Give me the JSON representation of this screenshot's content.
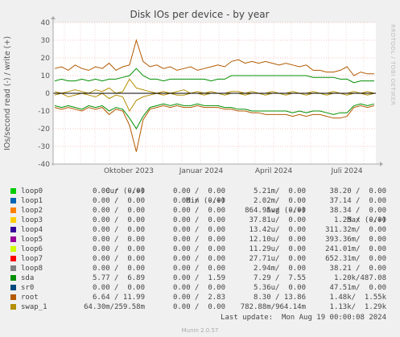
{
  "chart_data": {
    "type": "line",
    "title": "Disk IOs per device - by year",
    "ylabel": "IOs/second read (-) / write (+)",
    "ylim": [
      -40,
      40
    ],
    "yticks": [
      40,
      30,
      20,
      10,
      0,
      -10,
      -20,
      -30,
      -40
    ],
    "xtick_labels": [
      "Oktober 2023",
      "Januar 2024",
      "April 2024",
      "Juli 2024"
    ],
    "side_label": "RRDTOOL / TOBI OETIKER",
    "series": [
      {
        "name": "root",
        "write": [
          14,
          15,
          13,
          16,
          14,
          13,
          15,
          14,
          17,
          13,
          15,
          16,
          30,
          18,
          15,
          16,
          14,
          15,
          13,
          14,
          15,
          13,
          14,
          15,
          16,
          15,
          18,
          19,
          17,
          18,
          17,
          18,
          17,
          16,
          17,
          16,
          15,
          16,
          13,
          13,
          12,
          12,
          13,
          15,
          10,
          12,
          11,
          11
        ],
        "read": [
          -8,
          -9,
          -8,
          -9,
          -10,
          -8,
          -9,
          -8,
          -12,
          -9,
          -10,
          -18,
          -33,
          -15,
          -9,
          -8,
          -7,
          -8,
          -7,
          -8,
          -8,
          -7,
          -8,
          -8,
          -8,
          -9,
          -9,
          -10,
          -10,
          -11,
          -11,
          -12,
          -12,
          -12,
          -12,
          -13,
          -12,
          -13,
          -12,
          -12,
          -13,
          -14,
          -14,
          -13,
          -8,
          -7,
          -8,
          -7
        ]
      },
      {
        "name": "sda",
        "write": [
          7,
          8,
          7,
          7,
          8,
          7,
          8,
          7,
          8,
          8,
          9,
          10,
          14,
          10,
          8,
          8,
          7,
          8,
          8,
          8,
          8,
          8,
          8,
          7,
          8,
          8,
          10,
          10,
          10,
          10,
          10,
          10,
          10,
          10,
          10,
          10,
          10,
          10,
          9,
          9,
          9,
          9,
          8,
          8,
          6,
          7,
          7,
          7
        ],
        "read": [
          -7,
          -8,
          -7,
          -8,
          -9,
          -7,
          -8,
          -7,
          -10,
          -8,
          -9,
          -14,
          -20,
          -13,
          -8,
          -7,
          -6,
          -7,
          -6,
          -7,
          -7,
          -6,
          -7,
          -7,
          -7,
          -8,
          -8,
          -9,
          -9,
          -10,
          -10,
          -10,
          -10,
          -10,
          -10,
          -11,
          -10,
          -11,
          -10,
          -10,
          -11,
          -12,
          -11,
          -11,
          -7,
          -6,
          -7,
          -6
        ]
      },
      {
        "name": "swap_1",
        "write": [
          1,
          0,
          1,
          2,
          1,
          0,
          2,
          1,
          3,
          0,
          1,
          8,
          3,
          2,
          1,
          0,
          1,
          0,
          1,
          2,
          0,
          1,
          0,
          1,
          0,
          0,
          1,
          1,
          0,
          1,
          0,
          0,
          1,
          0,
          0,
          1,
          0,
          0,
          1,
          0,
          0,
          1,
          0,
          0,
          1,
          0,
          1,
          0
        ],
        "read": [
          -1,
          0,
          -2,
          -1,
          0,
          -1,
          -2,
          0,
          -3,
          -1,
          -2,
          -10,
          -4,
          -2,
          -1,
          0,
          -1,
          0,
          -1,
          -1,
          0,
          0,
          -1,
          0,
          0,
          -1,
          0,
          0,
          -1,
          0,
          0,
          -1,
          0,
          0,
          -1,
          0,
          0,
          -1,
          0,
          0,
          -1,
          0,
          0,
          -1,
          0,
          0,
          -1,
          0
        ]
      }
    ]
  },
  "legend": {
    "headers": {
      "cur": "Cur (-/+)",
      "min": "Min (-/+)",
      "avg": "Avg (-/+)",
      "max": "Max (-/+)"
    },
    "rows": [
      {
        "name": "loop0",
        "color": "#00cc00",
        "cur": "0.00 /  0.00",
        "min": "0.00 /  0.00",
        "avg": "5.21m/  0.00",
        "max": "38.20 /  0.00"
      },
      {
        "name": "loop1",
        "color": "#0066b3",
        "cur": "0.00 /  0.00",
        "min": "0.00 /  0.00",
        "avg": "2.02m/  0.00",
        "max": "37.14 /  0.00"
      },
      {
        "name": "loop2",
        "color": "#ff8000",
        "cur": "0.00 /  0.00",
        "min": "0.00 /  0.00",
        "avg": "864.95u/  0.00",
        "max": "38.34 /  0.00"
      },
      {
        "name": "loop3",
        "color": "#ffcc00",
        "cur": "0.00 /  0.00",
        "min": "0.00 /  0.00",
        "avg": "37.81u/  0.00",
        "max": "1.25 /  0.00"
      },
      {
        "name": "loop4",
        "color": "#330099",
        "cur": "0.00 /  0.00",
        "min": "0.00 /  0.00",
        "avg": "13.42u/  0.00",
        "max": "311.32m/  0.00"
      },
      {
        "name": "loop5",
        "color": "#990099",
        "cur": "0.00 /  0.00",
        "min": "0.00 /  0.00",
        "avg": "12.10u/  0.00",
        "max": "393.36m/  0.00"
      },
      {
        "name": "loop6",
        "color": "#ccff00",
        "cur": "0.00 /  0.00",
        "min": "0.00 /  0.00",
        "avg": "11.29u/  0.00",
        "max": "241.01m/  0.00"
      },
      {
        "name": "loop7",
        "color": "#ff0000",
        "cur": "0.00 /  0.00",
        "min": "0.00 /  0.00",
        "avg": "27.71u/  0.00",
        "max": "652.31m/  0.00"
      },
      {
        "name": "loop8",
        "color": "#808080",
        "cur": "0.00 /  0.00",
        "min": "0.00 /  0.00",
        "avg": "2.94m/  0.00",
        "max": "38.21 /  0.00"
      },
      {
        "name": "sda",
        "color": "#008f00",
        "cur": "5.77 /  6.89",
        "min": "0.00 /  1.59",
        "avg": "7.29 /  7.55",
        "max": "1.20k/487.08"
      },
      {
        "name": "sr0",
        "color": "#00487d",
        "cur": "0.00 /  0.00",
        "min": "0.00 /  0.00",
        "avg": "5.36u/  0.00",
        "max": "47.51m/  0.00"
      },
      {
        "name": "root",
        "color": "#b35a00",
        "cur": "6.64 / 11.99",
        "min": "0.00 /  2.83",
        "avg": "8.30 / 13.86",
        "max": "1.48k/  1.55k"
      },
      {
        "name": "swap_1",
        "color": "#b38f00",
        "cur": "64.30m/259.58m",
        "min": "0.00 /  0.00",
        "avg": "782.88m/964.14m",
        "max": "1.13k/  1.29k"
      }
    ]
  },
  "footer": {
    "last_update": "Last update:  Mon Aug 19 00:00:08 2024",
    "version": "Munin 2.0.57"
  }
}
